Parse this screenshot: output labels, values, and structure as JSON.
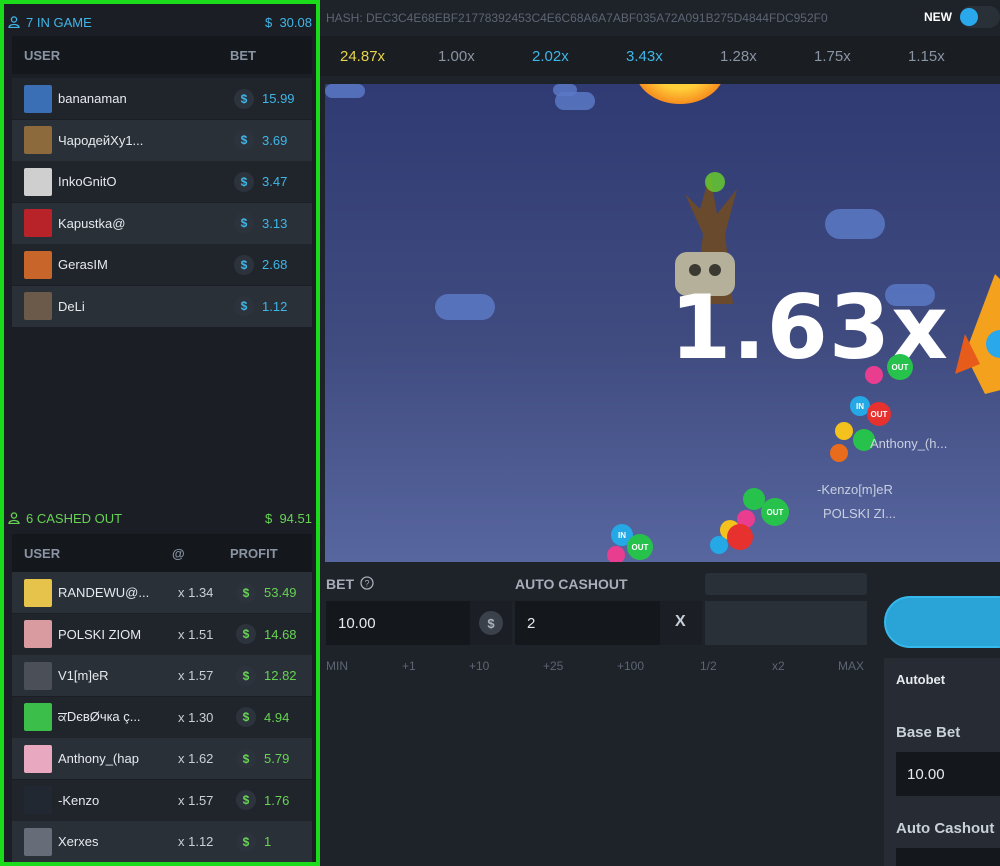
{
  "in_game": {
    "title": "7 IN GAME",
    "total": "30.08",
    "headers": {
      "user": "USER",
      "bet": "BET"
    },
    "rows": [
      {
        "name": "bananaman",
        "bet": "15.99"
      },
      {
        "name": "ЧародейXy1...",
        "bet": "3.69"
      },
      {
        "name": "InkoGnitO",
        "bet": "3.47"
      },
      {
        "name": "Kapustka@",
        "bet": "3.13"
      },
      {
        "name": "GerasIM",
        "bet": "2.68"
      },
      {
        "name": "DeLi",
        "bet": "1.12"
      }
    ]
  },
  "cashed_out": {
    "title": "6 CASHED OUT",
    "total": "94.51",
    "headers": {
      "user": "USER",
      "at": "@",
      "profit": "PROFIT"
    },
    "rows": [
      {
        "name": "RANDEWU@...",
        "mult": "x 1.34",
        "profit": "53.49"
      },
      {
        "name": "POLSKI ZIOM",
        "mult": "x 1.51",
        "profit": "14.68"
      },
      {
        "name": "V1[m]eR",
        "mult": "x 1.57",
        "profit": "12.82"
      },
      {
        "name": "ਕDєвØчкa ç...",
        "mult": "x 1.30",
        "profit": "4.94"
      },
      {
        "name": "Anthony_(hap",
        "mult": "x 1.62",
        "profit": "5.79"
      },
      {
        "name": "-Kenzo",
        "mult": "x 1.57",
        "profit": "1.76"
      },
      {
        "name": "Xerxes",
        "mult": "x 1.12",
        "profit": "1"
      }
    ]
  },
  "currency_symbol": "$",
  "hash": "HASH: DEC3C4E68EBF21778392453C4E6C68A6A7ABF035A72A091B275D4844FDC952F0",
  "new_label": "NEW",
  "history": [
    "24.87x",
    "1.00x",
    "2.02x",
    "3.43x",
    "1.28x",
    "1.75x",
    "1.15x"
  ],
  "current_multiplier": "1.63x",
  "player_labels": [
    "Anthony_(h...",
    "-Kenzo[m]eR",
    "POLSKI ZI..."
  ],
  "balloon_text": {
    "in": "IN",
    "out": "OUT"
  },
  "controls": {
    "bet_label": "BET",
    "bet_value": "10.00",
    "auto_cashout_label": "AUTO CASHOUT",
    "auto_cashout_value": "2",
    "x_label": "X",
    "quick": [
      "MIN",
      "+1",
      "+10",
      "+25",
      "+100",
      "1/2",
      "x2",
      "MAX"
    ]
  },
  "autobet": {
    "title": "Autobet",
    "base_bet_label": "Base Bet",
    "base_bet_value": "10.00",
    "auto_cashout_label": "Auto Cashout"
  },
  "colors": {
    "highlight_border": "#1bdc1b",
    "blue": "#3fb6e8",
    "green": "#67d353",
    "history_gold": "#e9d44a"
  }
}
